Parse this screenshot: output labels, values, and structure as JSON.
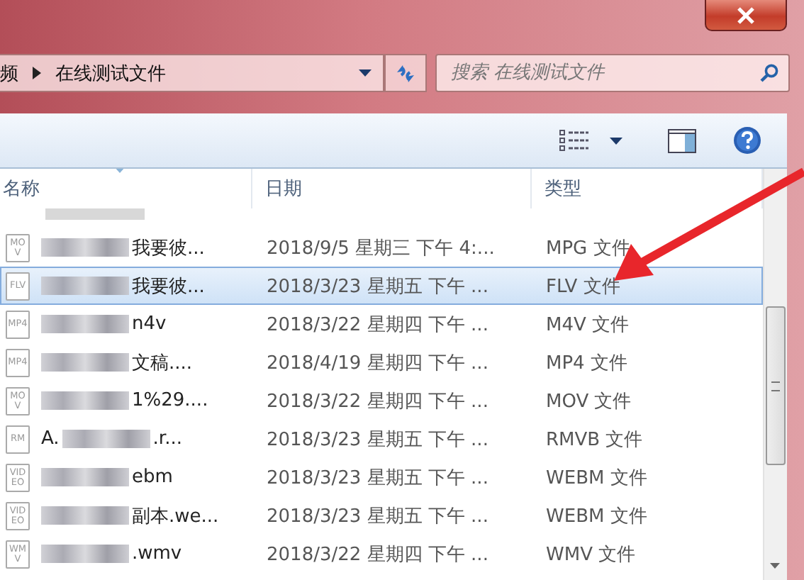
{
  "address_bar": {
    "crumbs": [
      "频",
      "在线测试文件"
    ]
  },
  "search": {
    "placeholder": "搜索 在线测试文件"
  },
  "columns": [
    "名称",
    "日期",
    "类型"
  ],
  "rows": [
    {
      "icon_label": "MOV",
      "name_suffix": "我要彼...",
      "date": "2018/9/5 星期三 下午 4:...",
      "type": "MPG 文件",
      "selected": false
    },
    {
      "icon_label": "FLV",
      "name_suffix": "我要彼...",
      "date": "2018/3/23 星期五 下午 ...",
      "type": "FLV 文件",
      "selected": true
    },
    {
      "icon_label": "MP4",
      "name_suffix": "n4v",
      "date": "2018/3/22 星期四 下午 ...",
      "type": "M4V 文件",
      "selected": false
    },
    {
      "icon_label": "MP4",
      "name_suffix": "文稿....",
      "date": "2018/4/19 星期四 下午 ...",
      "type": "MP4 文件",
      "selected": false
    },
    {
      "icon_label": "MOV",
      "name_suffix": "1%29....",
      "date": "2018/3/22 星期四 下午 ...",
      "type": "MOV 文件",
      "selected": false
    },
    {
      "icon_label": "RM",
      "name_prefix": "A.",
      "name_suffix": ".r...",
      "date": "2018/3/23 星期五 下午 ...",
      "type": "RMVB 文件",
      "selected": false
    },
    {
      "icon_label": "VIDEO",
      "name_suffix": "ebm",
      "date": "2018/3/23 星期五 下午 ...",
      "type": "WEBM 文件",
      "selected": false
    },
    {
      "icon_label": "VIDEO",
      "name_suffix": "副本.we...",
      "date": "2018/3/23 星期五 下午 ...",
      "type": "WEBM 文件",
      "selected": false
    },
    {
      "icon_label": "WMV",
      "name_suffix": ".wmv",
      "date": "2018/3/22 星期四 下午 ...",
      "type": "WMV 文件",
      "selected": false
    }
  ]
}
